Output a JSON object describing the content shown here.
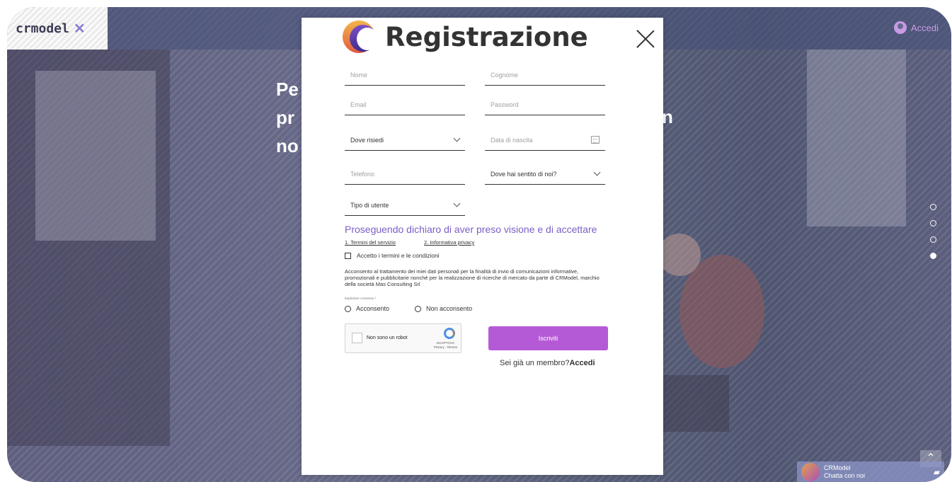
{
  "site": {
    "logo_text": "crmodel",
    "logo_mark": "✕",
    "login_label": "Accedi",
    "hero_lines": [
      "Pe",
      "pr",
      "no"
    ],
    "hero_right": "n",
    "slider_dots": 4,
    "slider_active_index": 3,
    "chat": {
      "title": "CRModel",
      "subtitle": "Chatta con noi"
    }
  },
  "modal": {
    "title": "Registrazione",
    "fields": {
      "nome": {
        "placeholder": "Nome"
      },
      "cognome": {
        "placeholder": "Cognome"
      },
      "email": {
        "placeholder": "Email"
      },
      "password": {
        "placeholder": "Password"
      },
      "dove_risiedi": {
        "value": "Dove risiedi"
      },
      "data_nascita": {
        "placeholder": "Data di nascita"
      },
      "telefono": {
        "placeholder": "Telefono"
      },
      "dove_sentito": {
        "value": "Dove hai sentito di noi?"
      },
      "tipo_utente": {
        "value": "Tipo di utente"
      }
    },
    "consent_title": "Proseguendo dichiaro di aver preso visione e di accettare",
    "consent_links": [
      "1. Termini del servizio",
      "2. Informativa privacy"
    ],
    "terms_checkbox_label": "Accetto i termini e le condizioni",
    "privacy_text": "Acconsento al trattamento dei miei dati personali per la finalità di invio di comunicazioni informative, promozionali e pubblicitarie nonché per la realizzazione di ricerche di mercato da parte di CRModel, marchio della società Mas Consulting Srl",
    "explicit_label": "Esplicitare consenso *",
    "radio_options": [
      "Acconsento",
      "Non acconsento"
    ],
    "recaptcha": {
      "label": "Non sono un robot",
      "brand": "reCAPTCHA",
      "links": "Privacy - Termini"
    },
    "submit_label": "Iscriviti",
    "member_text": "Sei già un membro?",
    "member_link": "Accedi"
  },
  "colors": {
    "accent": "#b55ad6",
    "link_purple": "#7c5ec7"
  }
}
